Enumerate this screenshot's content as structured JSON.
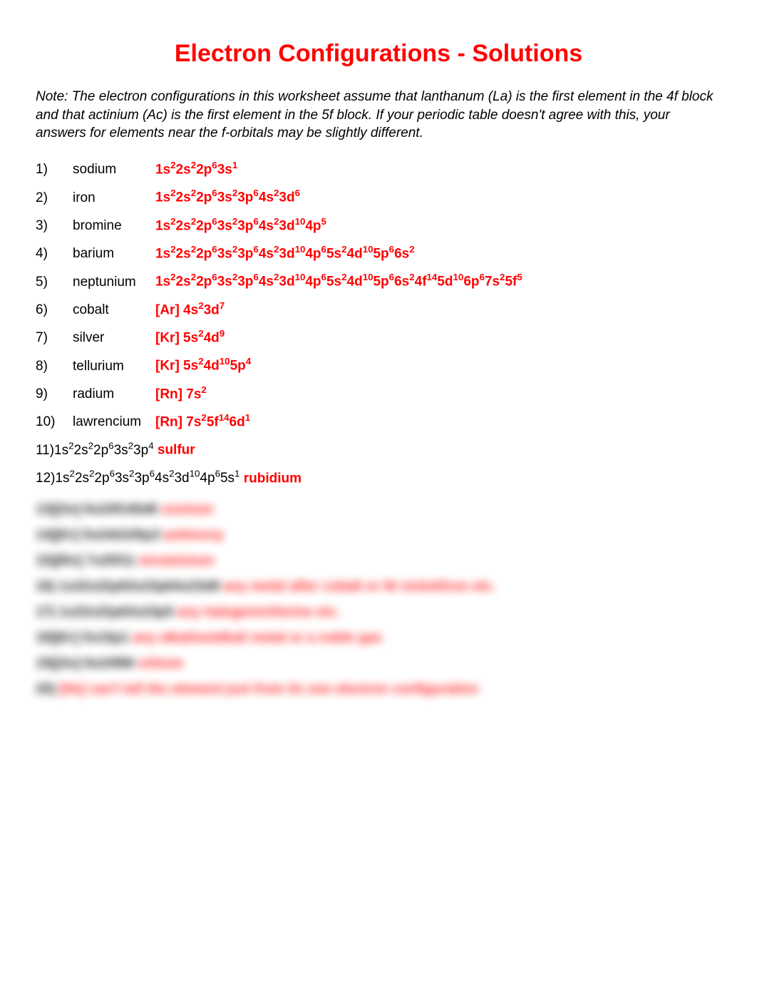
{
  "title": "Electron Configurations - Solutions",
  "note": "Note:  The electron configurations in this worksheet assume that lanthanum (La) is the first element in the 4f block and that actinium (Ac) is the first element in the 5f block.  If your periodic table doesn't agree with this, your answers for elements near the f-orbitals may be slightly different.",
  "items": [
    {
      "num": "1)",
      "element": "sodium",
      "config_html": "1s<sup>2</sup>2s<sup>2</sup>2p<sup>6</sup>3s<sup>1</sup>"
    },
    {
      "num": "2)",
      "element": "iron",
      "config_html": "1s<sup>2</sup>2s<sup>2</sup>2p<sup>6</sup>3s<sup>2</sup>3p<sup>6</sup>4s<sup>2</sup>3d<sup>6</sup>"
    },
    {
      "num": "3)",
      "element": "bromine",
      "config_html": "1s<sup>2</sup>2s<sup>2</sup>2p<sup>6</sup>3s<sup>2</sup>3p<sup>6</sup>4s<sup>2</sup>3d<sup>10</sup>4p<sup>5</sup>"
    },
    {
      "num": "4)",
      "element": "barium",
      "config_html": "1s<sup>2</sup>2s<sup>2</sup>2p<sup>6</sup>3s<sup>2</sup>3p<sup>6</sup>4s<sup>2</sup>3d<sup>10</sup>4p<sup>6</sup>5s<sup>2</sup>4d<sup>10</sup>5p<sup>6</sup>6s<sup>2</sup>"
    },
    {
      "num": "5)",
      "element": "neptunium",
      "config_html": "1s<sup>2</sup>2s<sup>2</sup>2p<sup>6</sup>3s<sup>2</sup>3p<sup>6</sup>4s<sup>2</sup>3d<sup>10</sup>4p<sup>6</sup>5s<sup>2</sup>4d<sup>10</sup>5p<sup>6</sup>6s<sup>2</sup>4f<sup>14</sup>5d<sup>10</sup>6p<sup>6</sup>7s<sup>2</sup>5f<sup>5</sup>"
    },
    {
      "num": "6)",
      "element": "cobalt",
      "config_html": "[Ar]  4s<sup>2</sup>3d<sup>7</sup>"
    },
    {
      "num": "7)",
      "element": "silver",
      "config_html": "[Kr]  5s<sup>2</sup>4d<sup>9</sup>"
    },
    {
      "num": "8)",
      "element": "tellurium",
      "config_html": "[Kr]  5s<sup>2</sup>4d<sup>10</sup>5p<sup>4</sup>"
    },
    {
      "num": "9)",
      "element": "radium",
      "config_html": "[Rn]  7s<sup>2</sup>"
    },
    {
      "num": "10)",
      "element": "lawrencium",
      "config_html": "[Rn]  7s<sup>2</sup>5f<sup>14</sup>6d<sup>1</sup>"
    }
  ],
  "reverse_items": [
    {
      "prefix_html": "11)1s<sup>2</sup>2s<sup>2</sup>2p<sup>6</sup>3s<sup>2</sup>3p<sup>4</sup>  ",
      "answer": "sulfur"
    },
    {
      "prefix_html": "12)1s<sup>2</sup>2s<sup>2</sup>2p<sup>6</sup>3s<sup>2</sup>3p<sup>6</sup>4s<sup>2</sup>3d<sup>10</sup>4p<sup>6</sup>5s<sup>1</sup>  ",
      "answer": "rubidium"
    }
  ],
  "blurred": [
    "13)[Xe] 6s24f145d6  osmium",
    "14)[Kr] 5s24d105p3  antimony",
    "15)[Rn] 7s25f11  einsteinium",
    "16) 1s22s22p63s23p64s23d8  any metal after cobalt or Ni nickel/iron etc.",
    "17) 1s22s22p63s23p5  any halogen/chlorine etc.",
    "18)[Kr] 5s15p1  any alkaline/alkali metal or a noble gas",
    "19)[Xe] 6s24f66  erbium",
    "20)  [He]  can't tell the element just from its one electron configuration"
  ]
}
